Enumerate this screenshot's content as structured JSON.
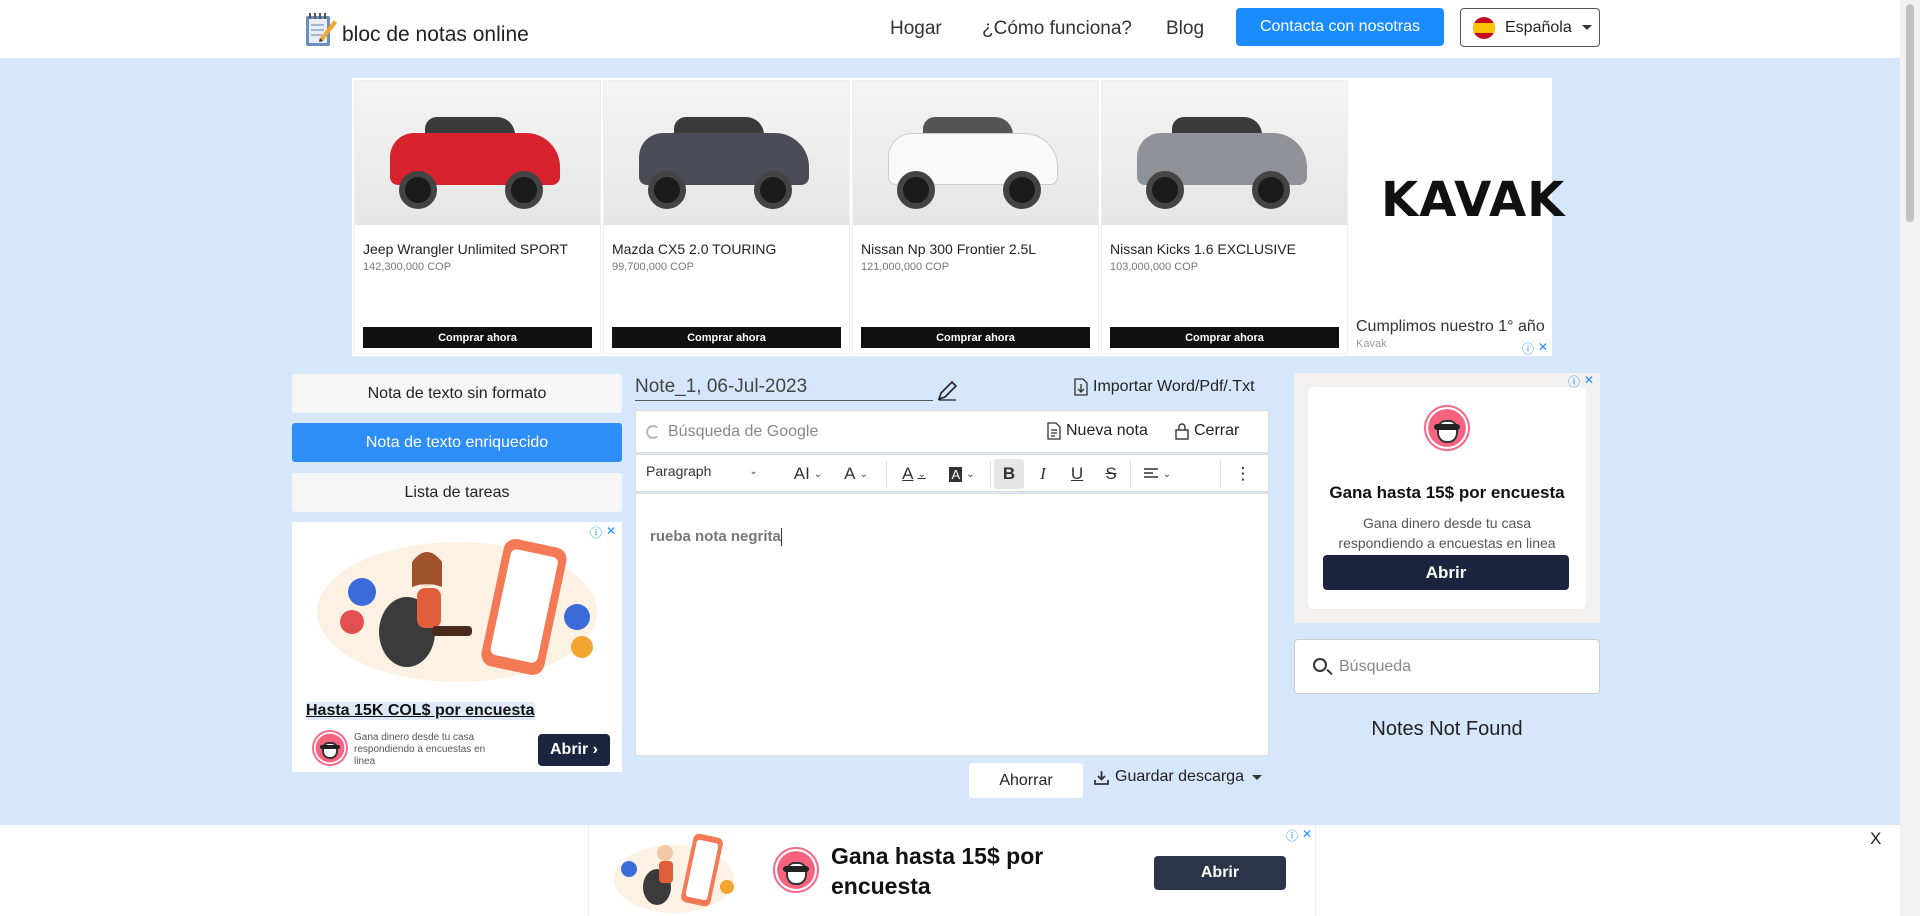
{
  "header": {
    "brand": "bloc de notas online",
    "nav": [
      "Hogar",
      "¿Cómo funciona?",
      "Blog"
    ],
    "contact_label": "Contacta con nosotras",
    "language": "Española"
  },
  "top_ad": {
    "cars": [
      {
        "name": "Jeep Wrangler Unlimited SPORT",
        "price": "142,300,000 COP",
        "cta": "Comprar ahora",
        "color": "#d8232f"
      },
      {
        "name": "Mazda CX5 2.0 TOURING",
        "price": "99,700,000 COP",
        "cta": "Comprar ahora",
        "color": "#4a4d55"
      },
      {
        "name": "Nissan Np 300 Frontier 2.5L",
        "price": "121,000,000 COP",
        "cta": "Comprar ahora",
        "color": "#f4f4f4"
      },
      {
        "name": "Nissan Kicks 1.6 EXCLUSIVE",
        "price": "103,000,000 COP",
        "cta": "Comprar ahora",
        "color": "#8f9297"
      }
    ],
    "brand_logo": "KAVAK",
    "tagline": "Cumplimos nuestro 1° año",
    "source": "Kavak"
  },
  "sidebar": {
    "items": [
      {
        "label": "Nota de texto sin formato",
        "active": false
      },
      {
        "label": "Nota de texto enriquecido",
        "active": true
      },
      {
        "label": "Lista de tareas",
        "active": false
      }
    ]
  },
  "left_ad": {
    "title": "Hasta 15K COL$ por encuesta",
    "desc": "Gana dinero desde tu casa respondiendo a encuestas en linea",
    "cta": "Abrir"
  },
  "editor": {
    "note_title": "Note_1, 06-Jul-2023",
    "import_label": "Importar Word/Pdf/.Txt",
    "search_placeholder": "Búsqueda de Google",
    "new_note_label": "Nueva nota",
    "close_label": "Cerrar",
    "toolbar": {
      "block_format": "Paragraph",
      "font_size_icon": "AI",
      "line_height_icon": "A",
      "font_color_icon": "A",
      "highlight_icon": "A",
      "bold": "B",
      "italic": "I",
      "underline": "U",
      "strike": "S",
      "more": "⋮"
    },
    "content": "rueba nota negrita",
    "save_label": "Ahorrar",
    "download_label": "Guardar descarga"
  },
  "right_ad": {
    "title": "Gana hasta 15$ por encuesta",
    "desc": "Gana dinero desde tu casa respondiendo a encuestas en linea",
    "cta": "Abrir"
  },
  "notes_search": {
    "placeholder": "Búsqueda",
    "empty_text": "Notes Not Found"
  },
  "bottom_ad": {
    "title": "Gana hasta 15$ por encuesta",
    "cta": "Abrir",
    "close": "X"
  },
  "colors": {
    "page_bg": "#d6e6fb",
    "accent": "#1a8cff",
    "active_tab": "#2e8ef7",
    "ad_button": "#1c2540"
  }
}
